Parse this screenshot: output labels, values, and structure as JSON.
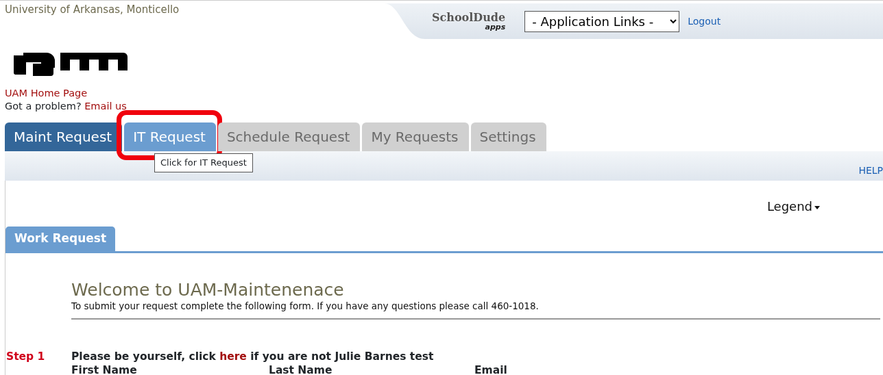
{
  "header": {
    "site_title": "University of Arkansas, Monticello",
    "brand": {
      "name": "SchoolDude",
      "sub": "apps"
    },
    "app_links": {
      "value": "- Application Links -"
    },
    "logout": "Logout"
  },
  "links": {
    "home": "UAM Home Page",
    "problem_prefix": "Got a problem?",
    "email": "Email us"
  },
  "tabs": [
    {
      "label": "Maint Request",
      "selected": true,
      "hovered": false,
      "annotated": false
    },
    {
      "label": "IT Request",
      "selected": false,
      "hovered": true,
      "annotated": true
    },
    {
      "label": "Schedule Request",
      "selected": false,
      "hovered": false,
      "annotated": false
    },
    {
      "label": "My Requests",
      "selected": false,
      "hovered": false,
      "annotated": false
    },
    {
      "label": "Settings",
      "selected": false,
      "hovered": false,
      "annotated": false
    }
  ],
  "tooltip": "Click for IT Request",
  "help": "HELP",
  "legend": "Legend",
  "section_tab": "Work Request",
  "welcome": {
    "title": "Welcome to UAM-Maintenenace",
    "subtitle": "To submit your request complete the following form. If you have any questions please call 460-1018."
  },
  "step": {
    "label": "Step 1",
    "sentence_before": "Please be yourself, click",
    "link": "here",
    "sentence_after": "if you are not Julie Barnes test",
    "columns": [
      "First Name",
      "Last Name",
      "Email"
    ]
  }
}
